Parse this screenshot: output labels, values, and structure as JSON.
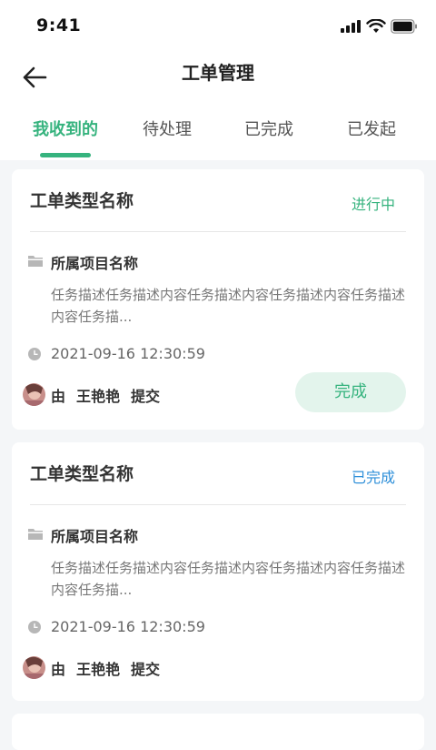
{
  "status_bar": {
    "time": "9:41"
  },
  "header": {
    "title": "工单管理",
    "back_icon": "arrow-left-icon"
  },
  "tabs": [
    {
      "label": "我收到的",
      "active": true
    },
    {
      "label": "待处理",
      "active": false
    },
    {
      "label": "已完成",
      "active": false
    },
    {
      "label": "已发起",
      "active": false
    }
  ],
  "tickets": [
    {
      "type_name": "工单类型名称",
      "status": "进行中",
      "project": "所属项目名称",
      "description": "任务描述任务描述内容任务描述内容任务描述内容任务描述内容任务描...",
      "datetime": "2021-09-16   12:30:59",
      "by_prefix": "由",
      "submitter": "王艳艳",
      "by_suffix": "提交",
      "action_label": "完成"
    },
    {
      "type_name": "工单类型名称",
      "status": "已完成",
      "project": "所属项目名称",
      "description": "任务描述任务描述内容任务描述内容任务描述内容任务描述内容任务描...",
      "datetime": "2021-09-16   12:30:59",
      "by_prefix": "由",
      "submitter": "王艳艳",
      "by_suffix": "提交"
    }
  ],
  "colors": {
    "accent": "#36b37e",
    "status_done": "#2e8fd9",
    "background": "#f4f6f8"
  }
}
